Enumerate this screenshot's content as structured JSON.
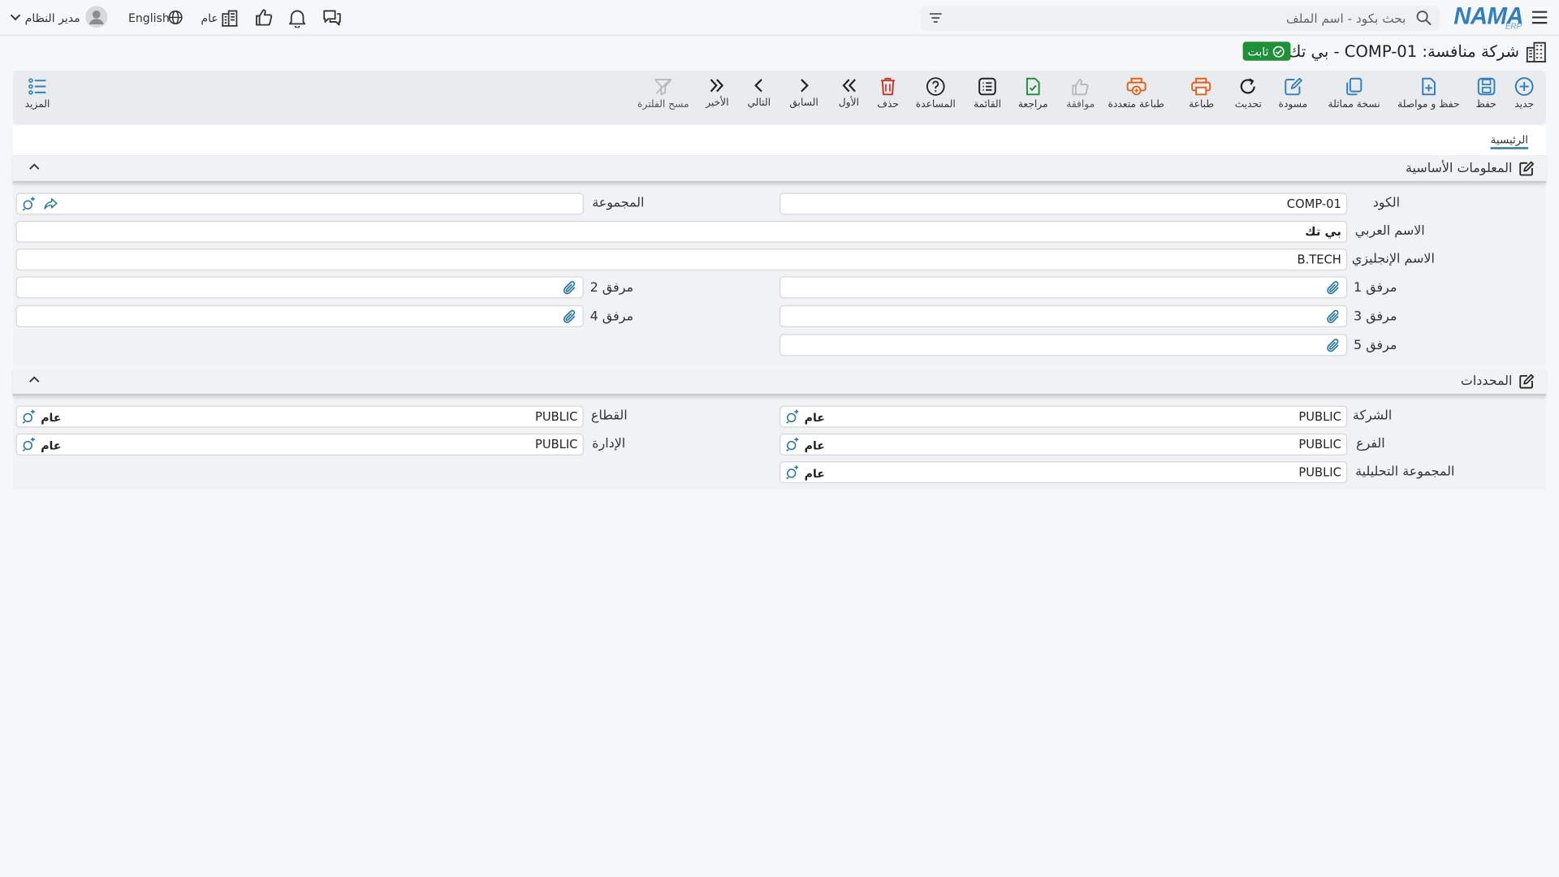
{
  "topbar": {
    "logo_text": "NAMA",
    "logo_sub": "ERP",
    "search_placeholder": "بحث بكود - اسم الملف",
    "branch_label": "عام",
    "language_label": "English",
    "user_name": "مدير النظام"
  },
  "titlebar": {
    "title": "شركة منافسة: COMP-01 - بي تك",
    "status_badge": "ثابت"
  },
  "toolbar": {
    "buttons": [
      {
        "label": "جديد",
        "icon": "plus-circle-icon"
      },
      {
        "label": "حفظ",
        "icon": "save-icon"
      },
      {
        "label": "حفظ و مواصلة",
        "icon": "save-continue-icon"
      },
      {
        "label": "نسخة مماثلة",
        "icon": "copy-icon"
      },
      {
        "label": "مسودة",
        "icon": "draft-icon"
      },
      {
        "label": "تحديث",
        "icon": "refresh-icon"
      },
      {
        "label": "طباعة",
        "icon": "print-icon"
      },
      {
        "label": "طباعة متعددة",
        "icon": "multi-print-icon"
      },
      {
        "label": "موافقة",
        "icon": "thumbs-up-icon"
      },
      {
        "label": "مراجعة",
        "icon": "review-icon"
      },
      {
        "label": "القائمة",
        "icon": "list-icon"
      },
      {
        "label": "المساعدة",
        "icon": "help-icon"
      },
      {
        "label": "حذف",
        "icon": "delete-icon"
      },
      {
        "label": "الأول",
        "icon": "first-icon"
      },
      {
        "label": "السابق",
        "icon": "previous-icon"
      },
      {
        "label": "التالي",
        "icon": "next-icon"
      },
      {
        "label": "الأخير",
        "icon": "last-icon"
      },
      {
        "label": "مسح الفلترة",
        "icon": "clear-filter-icon"
      }
    ],
    "more_label": "المزيد"
  },
  "tabs": {
    "main_label": "الرئيسية"
  },
  "basic_info": {
    "title": "المعلومات الأساسية",
    "code_label": "الكود",
    "code_value": "COMP-01",
    "group_label": "المجموعة",
    "group_value": "",
    "arabic_name_label": "الاسم العربي",
    "arabic_name_value": "بي تك",
    "english_name_label": "الاسم الإنجليزي",
    "english_name_value": "B.TECH",
    "attachment1_label": "مرفق 1",
    "attachment2_label": "مرفق 2",
    "attachment3_label": "مرفق 3",
    "attachment4_label": "مرفق 4",
    "attachment5_label": "مرفق 5"
  },
  "dimensions": {
    "title": "المحددات",
    "company_label": "الشركة",
    "company_code": "PUBLIC",
    "company_desc": "عام",
    "sector_label": "القطاع",
    "sector_code": "PUBLIC",
    "sector_desc": "عام",
    "branch_label": "الفرع",
    "branch_code": "PUBLIC",
    "branch_desc": "عام",
    "department_label": "الإدارة",
    "department_code": "PUBLIC",
    "department_desc": "عام",
    "analysis_group_label": "المجموعة التحليلية",
    "analysis_group_code": "PUBLIC",
    "analysis_group_desc": "عام"
  },
  "colors": {
    "accent": "#2b7a9c",
    "primary_icon": "#2f7fc1",
    "print_orange": "#e0611a",
    "delete_red": "#c0392b",
    "success_green": "#1f8f3a"
  }
}
